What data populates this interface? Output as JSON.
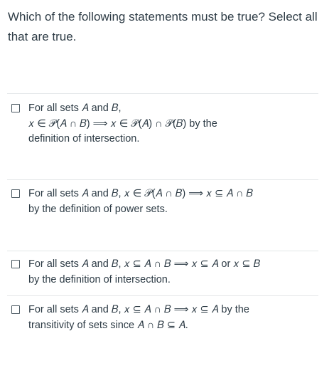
{
  "question": {
    "text": "Which of the following statements must be true?  Select all that are true."
  },
  "options": [
    {
      "lines": [
        "For all sets 𝐴 and 𝐵,",
        "𝑥 ∈ 𝒫(𝐴 ∩ 𝐵)  ⟹  𝑥 ∈ 𝒫(𝐴) ∩ 𝒫(𝐵) by the",
        "definition of intersection."
      ],
      "checked": false
    },
    {
      "lines": [
        "For all sets 𝐴 and 𝐵, 𝑥 ∈ 𝒫(𝐴 ∩ 𝐵)  ⟹  𝑥 ⊆ 𝐴 ∩ 𝐵",
        "by the definition of power sets."
      ],
      "checked": false
    },
    {
      "lines": [
        "For all sets 𝐴 and 𝐵, 𝑥 ⊆ 𝐴 ∩ 𝐵  ⟹  𝑥 ⊆ 𝐴 or 𝑥 ⊆ 𝐵",
        "by the definition of intersection."
      ],
      "checked": false
    },
    {
      "lines": [
        "For all sets 𝐴 and 𝐵, 𝑥 ⊆ 𝐴 ∩ 𝐵  ⟹  𝑥 ⊆ 𝐴 by the",
        "transitivity of sets since 𝐴 ∩ 𝐵 ⊆ 𝐴."
      ],
      "checked": false
    }
  ]
}
